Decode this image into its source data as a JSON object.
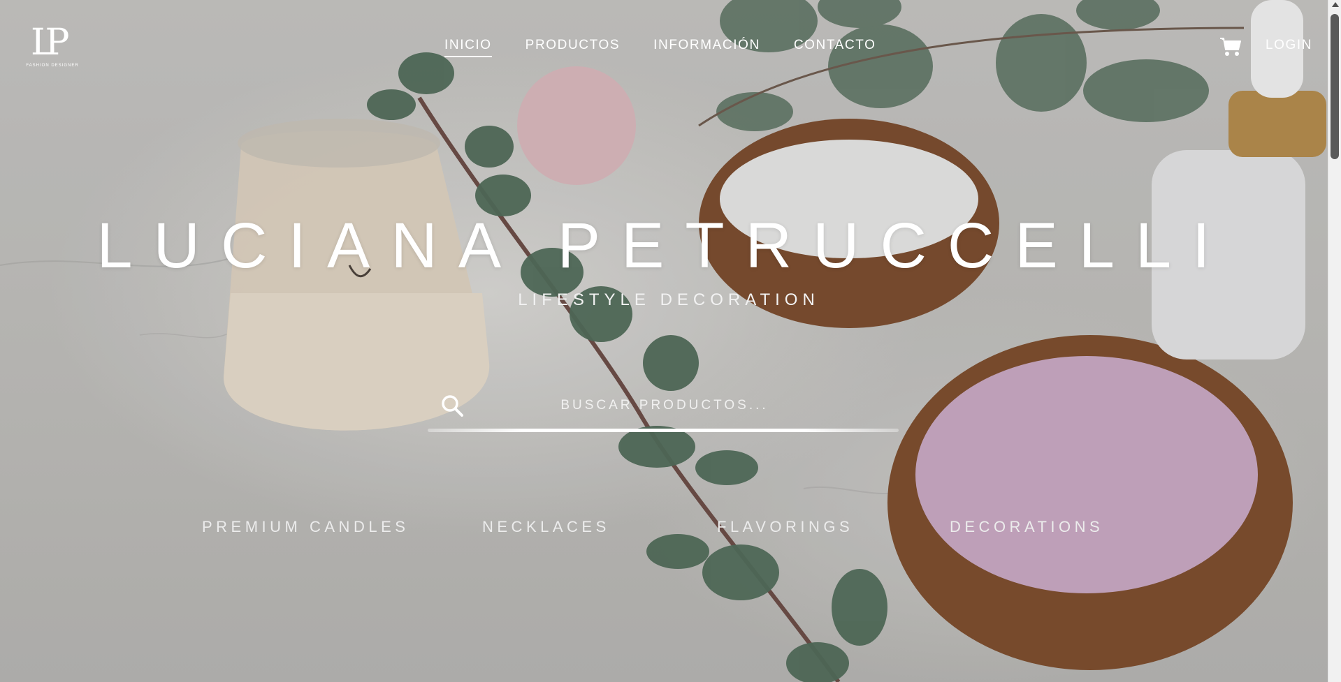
{
  "logo": {
    "mark": "LP",
    "subtitle": "FASHION DESIGNER"
  },
  "nav": {
    "items": [
      {
        "label": "INICIO",
        "active": true
      },
      {
        "label": "PRODUCTOS",
        "active": false
      },
      {
        "label": "INFORMACIÓN",
        "active": false
      },
      {
        "label": "CONTACTO",
        "active": false
      }
    ]
  },
  "header": {
    "cart_icon": "cart-icon",
    "login_label": "LOGIN"
  },
  "hero": {
    "title": "LUCIANA PETRUCCELLI",
    "subtitle": "LIFESTYLE DECORATION"
  },
  "search": {
    "placeholder": "BUSCAR PRODUCTOS...",
    "value": "",
    "icon": "search-icon"
  },
  "categories": [
    "PREMIUM CANDLES",
    "NECKLACES",
    "FLAVORINGS",
    "DECORATIONS"
  ],
  "colors": {
    "text": "#ffffff",
    "background": "#bdbcb9"
  }
}
